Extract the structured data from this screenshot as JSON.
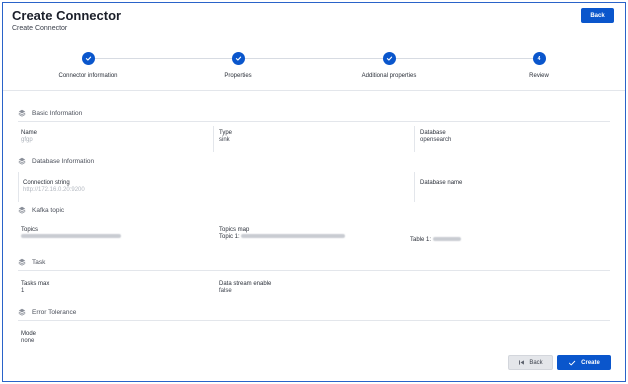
{
  "header": {
    "title": "Create Connector",
    "subtitle": "Create Connector",
    "back_label": "Back"
  },
  "stepper": {
    "steps": [
      {
        "label": "Connector information",
        "state": "done"
      },
      {
        "label": "Properties",
        "state": "done"
      },
      {
        "label": "Additional properties",
        "state": "done"
      },
      {
        "label": "Review",
        "state": "current",
        "number": "4"
      }
    ]
  },
  "basic_information": {
    "heading": "Basic Information",
    "name_label": "Name",
    "name_value": "gfgp",
    "type_label": "Type",
    "type_value": "sink",
    "database_label": "Database",
    "database_value": "opensearch"
  },
  "database_information": {
    "heading": "Database Information",
    "connection_label": "Connection string",
    "connection_value": "http://172.16.0.20:9200",
    "database_name_label": "Database name"
  },
  "kafka_topic": {
    "heading": "Kafka topic",
    "topics_label": "Topics",
    "topics_map_label": "Topics map",
    "topic_prefix": "Topic 1:",
    "table_prefix": "Table 1:"
  },
  "task": {
    "heading": "Task",
    "tasks_max_label": "Tasks max",
    "tasks_max_value": "1",
    "data_stream_label": "Data stream enable",
    "data_stream_value": "false"
  },
  "error_tolerance": {
    "heading": "Error Tolerance",
    "mode_label": "Mode",
    "mode_value": "none"
  },
  "footer": {
    "back_label": "Back",
    "create_label": "Create"
  },
  "colors": {
    "primary": "#0a56cc",
    "frame_border": "#2a63c9"
  }
}
